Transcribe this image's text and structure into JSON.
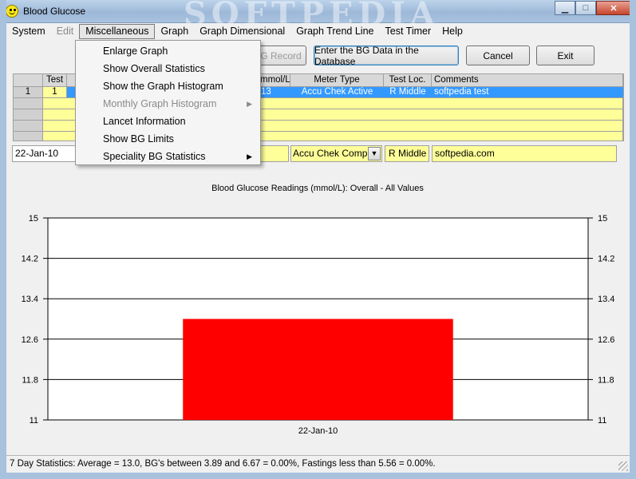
{
  "window": {
    "title": "Blood Glucose",
    "watermark": "SOFTPEDIA"
  },
  "menubar": [
    "System",
    "Edit",
    "Miscellaneous",
    "Graph",
    "Graph Dimensional",
    "Graph Trend Line",
    "Test Timer",
    "Help"
  ],
  "misc_menu": {
    "items": [
      {
        "label": "Enlarge Graph"
      },
      {
        "label": "Show Overall Statistics"
      },
      {
        "label": "Show the Graph Histogram"
      },
      {
        "label": "Monthly Graph Histogram"
      },
      {
        "label": "Lancet Information"
      },
      {
        "label": "Show BG Limits"
      },
      {
        "label": "Speciality BG Statistics"
      }
    ]
  },
  "toolbar": {
    "add_record_label": "G Record",
    "enter_label": "Enter the BG  Data in the Database",
    "cancel_label": "Cancel",
    "exit_label": "Exit"
  },
  "grid": {
    "headers": {
      "test": "Test",
      "mmol": "mmol/L",
      "meter": "Meter Type",
      "loc": "Test Loc.",
      "comments": "Comments"
    },
    "row1": {
      "num": "1",
      "test": "1",
      "mmol": "13",
      "meter": "Accu Chek Active",
      "loc": "R Middle",
      "comments": "softpedia test"
    }
  },
  "edit_row": {
    "date": "22-Jan-10",
    "meter": "Accu Chek Complet",
    "loc": "R Middle",
    "comments": "softpedia.com"
  },
  "chart_data": {
    "type": "bar",
    "title": "Blood Glucose Readings (mmol/L): Overall - All Values",
    "categories": [
      "22-Jan-10"
    ],
    "values": [
      13.0
    ],
    "ylim": [
      11,
      15
    ],
    "yticks": [
      "15",
      "14.2",
      "13.4",
      "12.6",
      "11.8",
      "11"
    ],
    "xlabel": "",
    "ylabel": "",
    "bar_color": "#ff0000",
    "grid": true
  },
  "status": {
    "text": "7 Day Statistics: Average = 13.0, BG's between 3.89 and 6.67 = 0.00%, Fastings less than 5.56 = 0.00%."
  }
}
